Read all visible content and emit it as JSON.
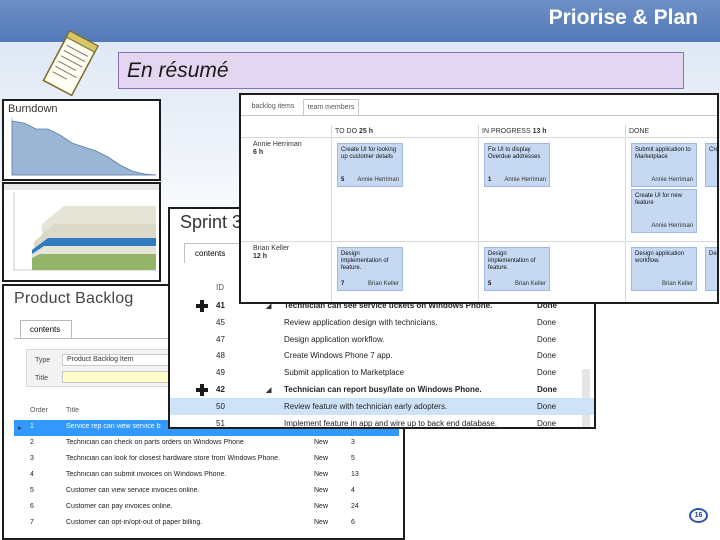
{
  "slide": {
    "title": "Priorise & Plan",
    "subtitle": "En résumé",
    "page_number": "16"
  },
  "burndown": {
    "title": "Burndown"
  },
  "product_backlog": {
    "title": "Product Backlog",
    "tab": "contents",
    "filter": {
      "type_label": "Type",
      "type_value": "Product Backlog Item",
      "title_label": "Title"
    },
    "columns": [
      "Order",
      "Title"
    ],
    "rows": [
      {
        "order": "1",
        "title": "Service rep can view service b",
        "state": "",
        "effort": "",
        "selected": true
      },
      {
        "order": "2",
        "title": "Technician can check on parts orders on Windows Phone",
        "state": "New",
        "effort": "3",
        "selected": false
      },
      {
        "order": "3",
        "title": "Technician can look for closest hardware store from Windows Phone.",
        "state": "New",
        "effort": "5",
        "selected": false
      },
      {
        "order": "4",
        "title": "Technician can submit invoices on Windows Phone.",
        "state": "New",
        "effort": "13",
        "selected": false
      },
      {
        "order": "5",
        "title": "Customer can view service invoices online.",
        "state": "New",
        "effort": "4",
        "selected": false
      },
      {
        "order": "6",
        "title": "Customer can pay invoices online.",
        "state": "New",
        "effort": "24",
        "selected": false
      },
      {
        "order": "7",
        "title": "Customer can opt-in/opt-out of paper billing.",
        "state": "New",
        "effort": "6",
        "selected": false
      }
    ]
  },
  "sprint": {
    "title": "Sprint 3",
    "tab": "contents",
    "id_header": "ID",
    "rows": [
      {
        "id": "41",
        "title": "Technician can see service tickets on Windows Phone.",
        "state": "Done",
        "plus": true,
        "bold": true,
        "selected": false
      },
      {
        "id": "45",
        "title": "Review application design with technicians.",
        "state": "Done",
        "plus": false,
        "bold": false,
        "selected": false
      },
      {
        "id": "47",
        "title": "Design application workflow.",
        "state": "Done",
        "plus": false,
        "bold": false,
        "selected": false
      },
      {
        "id": "48",
        "title": "Create Windows Phone 7 app.",
        "state": "Done",
        "plus": false,
        "bold": false,
        "selected": false
      },
      {
        "id": "49",
        "title": "Submit application to Marketplace",
        "state": "Done",
        "plus": false,
        "bold": false,
        "selected": false
      },
      {
        "id": "42",
        "title": "Technician can report busy/late on Windows Phone.",
        "state": "Done",
        "plus": true,
        "bold": true,
        "selected": false
      },
      {
        "id": "50",
        "title": "Review feature with technician early adopters.",
        "state": "Done",
        "plus": false,
        "bold": false,
        "selected": true
      },
      {
        "id": "51",
        "title": "Implement feature in app and wire up to back end database.",
        "state": "Done",
        "plus": false,
        "bold": false,
        "selected": false
      }
    ]
  },
  "board": {
    "tabs": [
      "backlog items",
      "team members"
    ],
    "columns": [
      {
        "label": "TO DO",
        "hours": "25 h"
      },
      {
        "label": "IN PROGRESS",
        "hours": "13 h"
      },
      {
        "label": "DONE",
        "hours": ""
      }
    ],
    "people": [
      {
        "name": "Annie Herriman",
        "hours": "6 h"
      },
      {
        "name": "Brian Keller",
        "hours": "12 h"
      }
    ],
    "cards": [
      {
        "title": "Create UI for looking up customer details",
        "num": "5",
        "owner": "Annie Herriman"
      },
      {
        "title": "Fix UI to display Overdue addresses",
        "num": "1",
        "owner": "Annie Herriman"
      },
      {
        "title": "Submit application to Marketplace",
        "num": "",
        "owner": "Annie Herriman"
      },
      {
        "title": "Create UI for new feature",
        "num": "",
        "owner": "Annie Herriman"
      },
      {
        "title": "Design implementation of feature.",
        "num": "7",
        "owner": "Brian Keller"
      },
      {
        "title": "Design implementation of feature.",
        "num": "5",
        "owner": "Brian Keller"
      },
      {
        "title": "Design application workflow.",
        "num": "",
        "owner": "Brian Keller"
      },
      {
        "title": "Creat",
        "num": "",
        "owner": ""
      },
      {
        "title": "Desi impl",
        "num": "",
        "owner": ""
      }
    ]
  }
}
